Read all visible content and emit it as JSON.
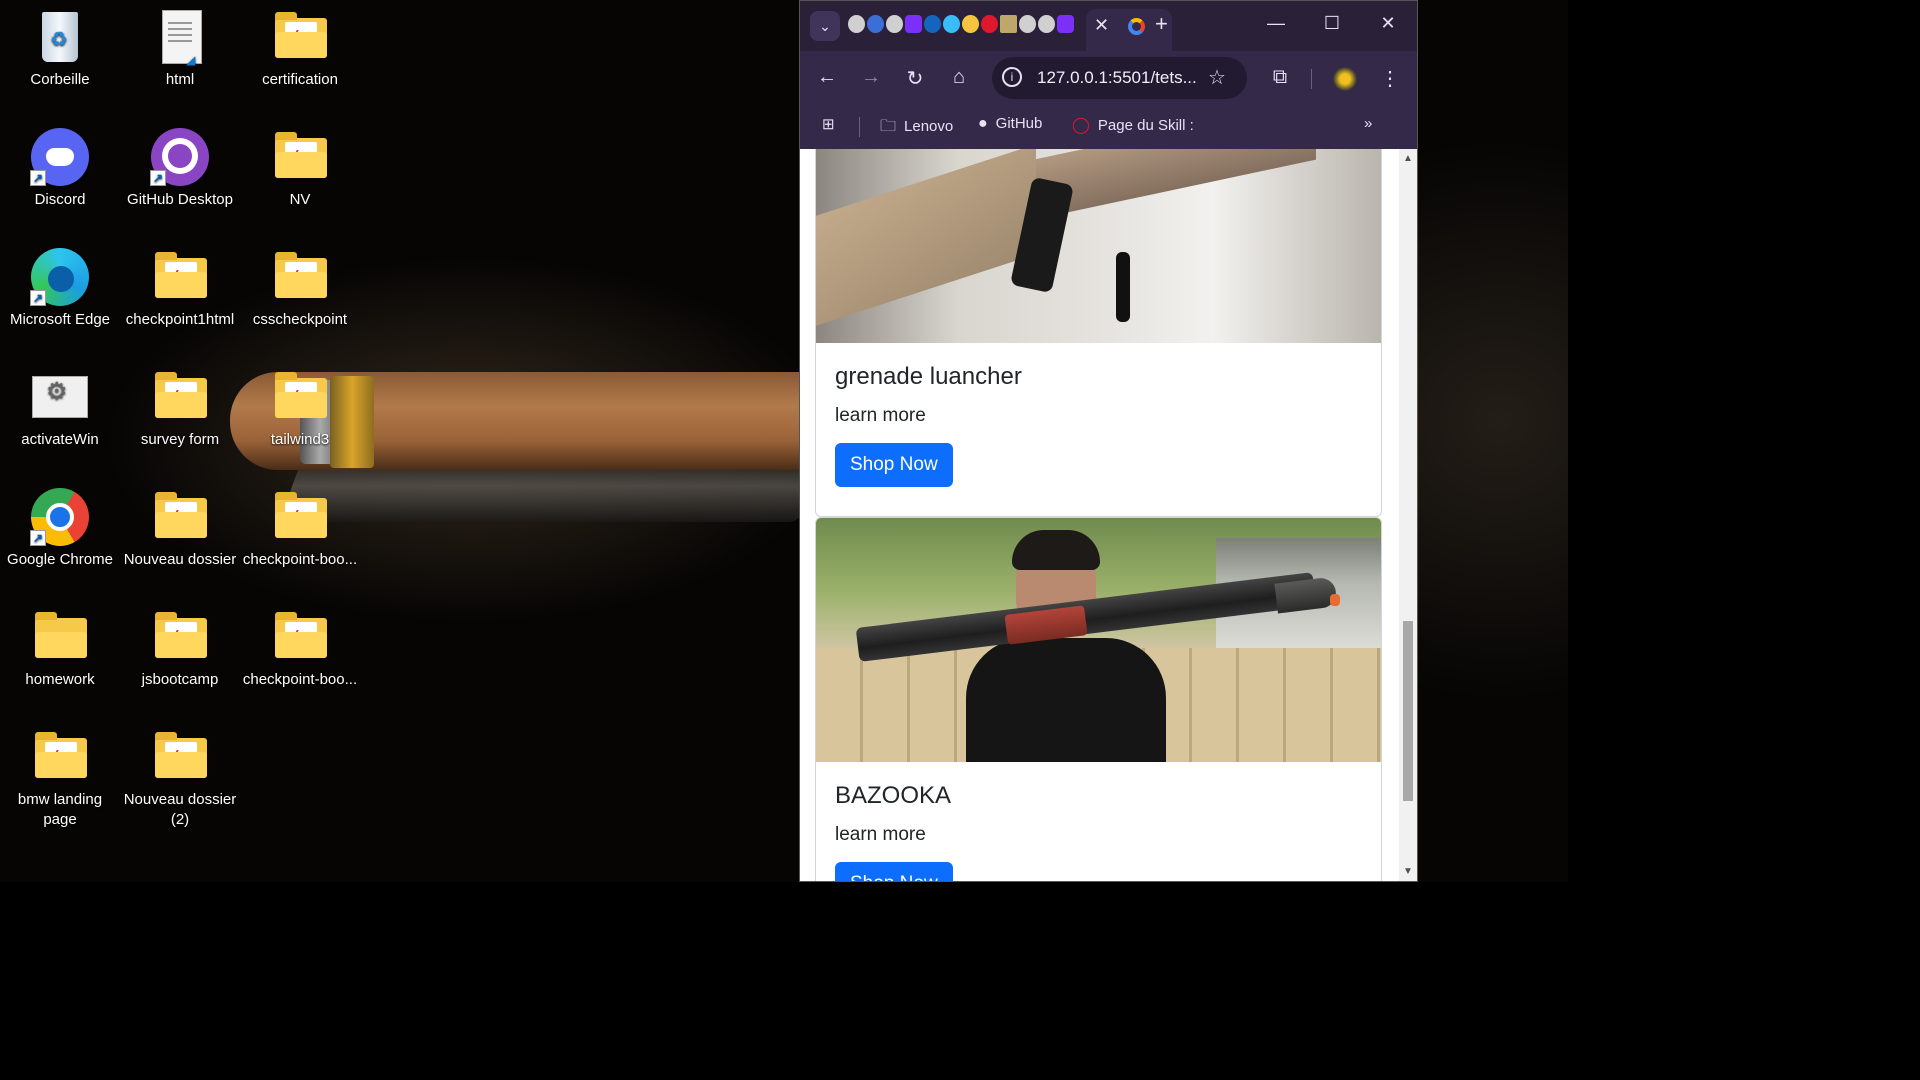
{
  "desktop": {
    "icons": [
      {
        "label": "Corbeille"
      },
      {
        "label": "html"
      },
      {
        "label": "certification"
      },
      {
        "label": "Discord"
      },
      {
        "label": "GitHub Desktop"
      },
      {
        "label": "NV"
      },
      {
        "label": "Microsoft Edge"
      },
      {
        "label": "checkpoint1html"
      },
      {
        "label": "csscheckpoint"
      },
      {
        "label": "activateWin"
      },
      {
        "label": "survey form"
      },
      {
        "label": "tailwind3"
      },
      {
        "label": "Google Chrome"
      },
      {
        "label": "Nouveau dossier"
      },
      {
        "label": "checkpoint-boo..."
      },
      {
        "label": "homework"
      },
      {
        "label": "jsbootcamp"
      },
      {
        "label": "checkpoint-boo..."
      },
      {
        "label": "bmw landing page"
      },
      {
        "label": "Nouveau dossier (2)"
      }
    ]
  },
  "browser": {
    "url": "127.0.0.1:5501/tets...",
    "tab_close": "✕",
    "new_tab": "+",
    "bookmarks": [
      {
        "label": "Lenovo",
        "icon": "folder-icon"
      },
      {
        "label": "GitHub",
        "icon": "github-icon"
      },
      {
        "label": "Page du Skill :",
        "icon": "opera-icon"
      }
    ],
    "colors": {
      "frame": "#35294a",
      "tabstrip": "#2a2038",
      "accent_button": "#0d6efd"
    }
  },
  "page": {
    "cards": [
      {
        "title": "grenade luancher",
        "text": "learn more",
        "button": "Shop Now"
      },
      {
        "title": "BAZOOKA",
        "text": "learn more",
        "button": "Shop Now"
      }
    ]
  }
}
